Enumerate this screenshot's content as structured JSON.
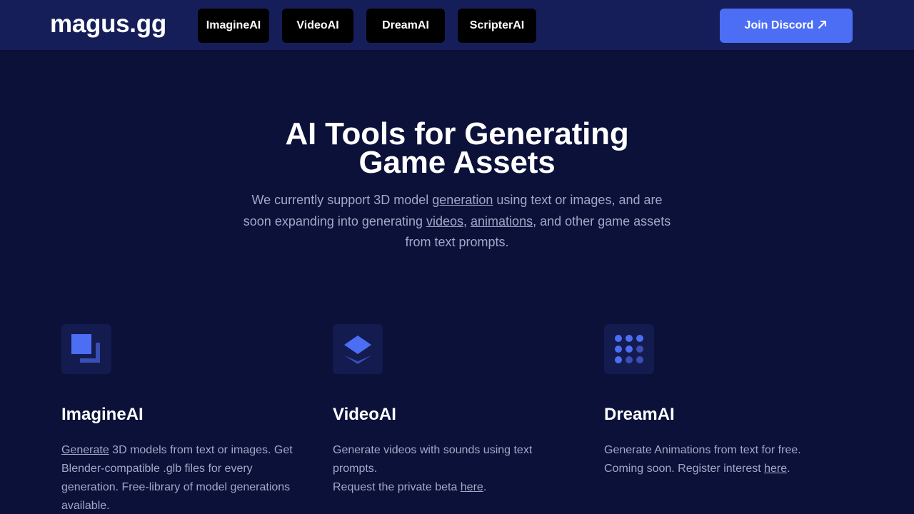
{
  "header": {
    "logo": "magus.gg",
    "nav": [
      {
        "label": "ImagineAI"
      },
      {
        "label": "VideoAI"
      },
      {
        "label": "DreamAI"
      },
      {
        "label": "ScripterAI"
      }
    ],
    "discord_label": "Join Discord",
    "discord_icon": "arrow-up-right-icon"
  },
  "hero": {
    "title_line1": "AI Tools for Generating",
    "title_line2": "Game Assets",
    "sub_1": "We currently support 3D model ",
    "sub_link_generation": "generation",
    "sub_2": " using text or images, and are soon expanding into generating ",
    "sub_link_videos": "videos",
    "sub_3": ", ",
    "sub_link_animations": "animations",
    "sub_4": ", and other game assets from text prompts."
  },
  "cards": [
    {
      "icon": "squares-icon",
      "title": "ImagineAI",
      "link": "Generate",
      "desc": " 3D models from text or images. Get Blender-compatible .glb files for every generation. Free-library of model generations available."
    },
    {
      "icon": "layers-icon",
      "title": "VideoAI",
      "desc_line1": "Generate videos with sounds using text prompts.",
      "desc_line2_pre": "Request the private beta ",
      "link": "here",
      "desc_line2_post": "."
    },
    {
      "icon": "dots-grid-icon",
      "title": "DreamAI",
      "desc_line1": "Generate Animations from text for free.",
      "desc_line2_pre": "Coming soon. Register interest ",
      "link": "here",
      "desc_line2_post": "."
    }
  ],
  "colors": {
    "background": "#0b1139",
    "header": "#161e5a",
    "accent": "#4c6ef5",
    "muted_text": "#a3a8c8"
  }
}
